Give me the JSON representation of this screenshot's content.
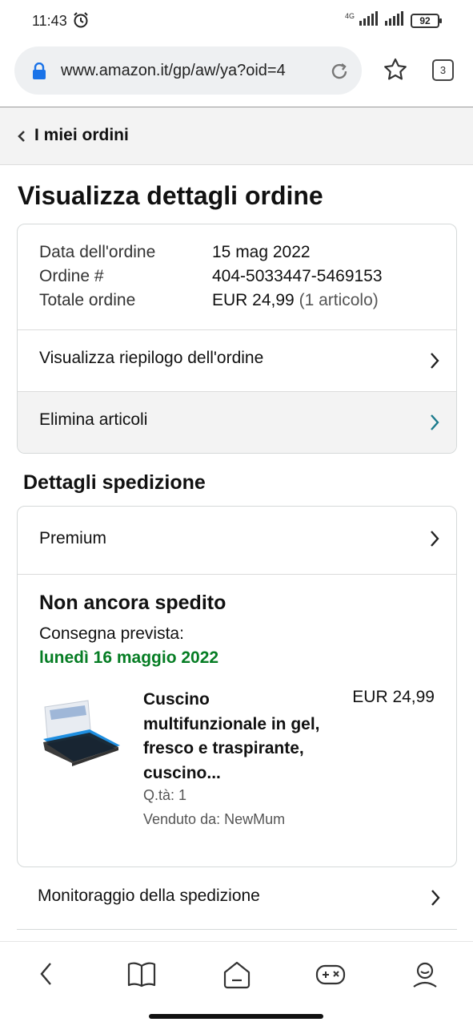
{
  "status_bar": {
    "time": "11:43",
    "network": "4G",
    "battery": "92"
  },
  "browser": {
    "url": "www.amazon.it/gp/aw/ya?oid=4",
    "tab_count": "3"
  },
  "back_nav": {
    "label": "I miei ordini"
  },
  "page": {
    "title": "Visualizza dettagli ordine"
  },
  "order": {
    "date_label": "Data dell'ordine",
    "date_value": "15 mag 2022",
    "number_label": "Ordine #",
    "number_value": "404-5033447-5469153",
    "total_label": "Totale ordine",
    "total_value": "EUR 24,99",
    "total_items": "(1 articolo)",
    "summary_link": "Visualizza riepilogo dell'ordine",
    "delete_link": "Elimina articoli"
  },
  "shipping": {
    "section_title": "Dettagli spedizione",
    "service": "Premium",
    "status": "Non ancora spedito",
    "delivery_label": "Consegna prevista:",
    "delivery_date": "lunedì 16 maggio 2022",
    "product": {
      "name": "Cuscino multifunzionale in gel, fresco e traspirante, cuscino...",
      "price": "EUR 24,99",
      "qty": "Q.tà: 1",
      "seller": "Venduto da: NewMum"
    },
    "tracking_link": "Monitoraggio della spedizione"
  },
  "colors": {
    "delivery_green": "#067d24",
    "chevron_teal": "#1a7a8c",
    "lock_blue": "#1a73e8"
  }
}
